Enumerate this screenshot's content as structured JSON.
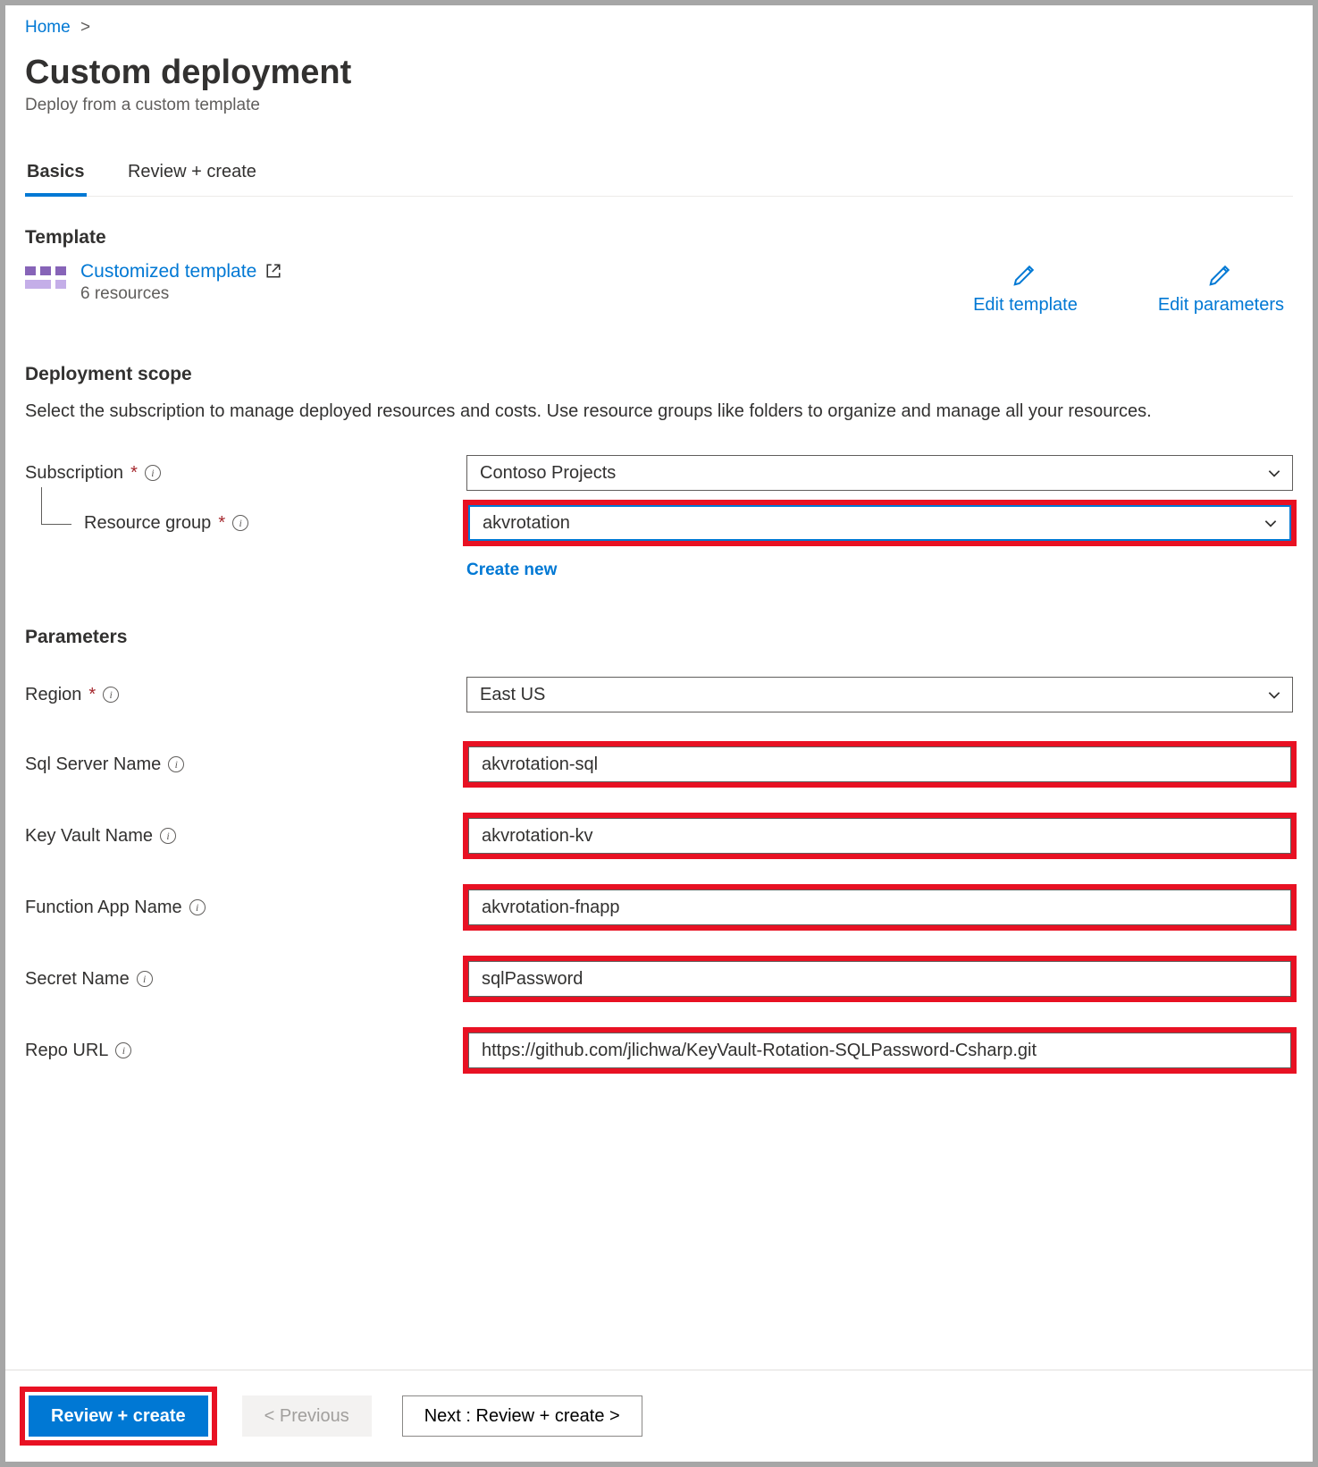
{
  "breadcrumb": {
    "home": "Home"
  },
  "title": "Custom deployment",
  "subtitle": "Deploy from a custom template",
  "tabs": {
    "basics": "Basics",
    "review": "Review + create"
  },
  "template_section": {
    "header": "Template",
    "link_label": "Customized template",
    "resource_count": "6 resources",
    "edit_template": "Edit template",
    "edit_parameters": "Edit parameters"
  },
  "scope": {
    "header": "Deployment scope",
    "desc": "Select the subscription to manage deployed resources and costs. Use resource groups like folders to organize and manage all your resources.",
    "subscription_label": "Subscription",
    "subscription_value": "Contoso Projects",
    "rg_label": "Resource group",
    "rg_value": "akvrotation",
    "create_new": "Create new"
  },
  "params": {
    "header": "Parameters",
    "region_label": "Region",
    "region_value": "East US",
    "sql_label": "Sql Server Name",
    "sql_value": "akvrotation-sql",
    "kv_label": "Key Vault Name",
    "kv_value": "akvrotation-kv",
    "fn_label": "Function App Name",
    "fn_value": "akvrotation-fnapp",
    "secret_label": "Secret Name",
    "secret_value": "sqlPassword",
    "repo_label": "Repo URL",
    "repo_value": "https://github.com/jlichwa/KeyVault-Rotation-SQLPassword-Csharp.git"
  },
  "footer": {
    "review": "Review + create",
    "prev": "< Previous",
    "next": "Next : Review + create >"
  }
}
